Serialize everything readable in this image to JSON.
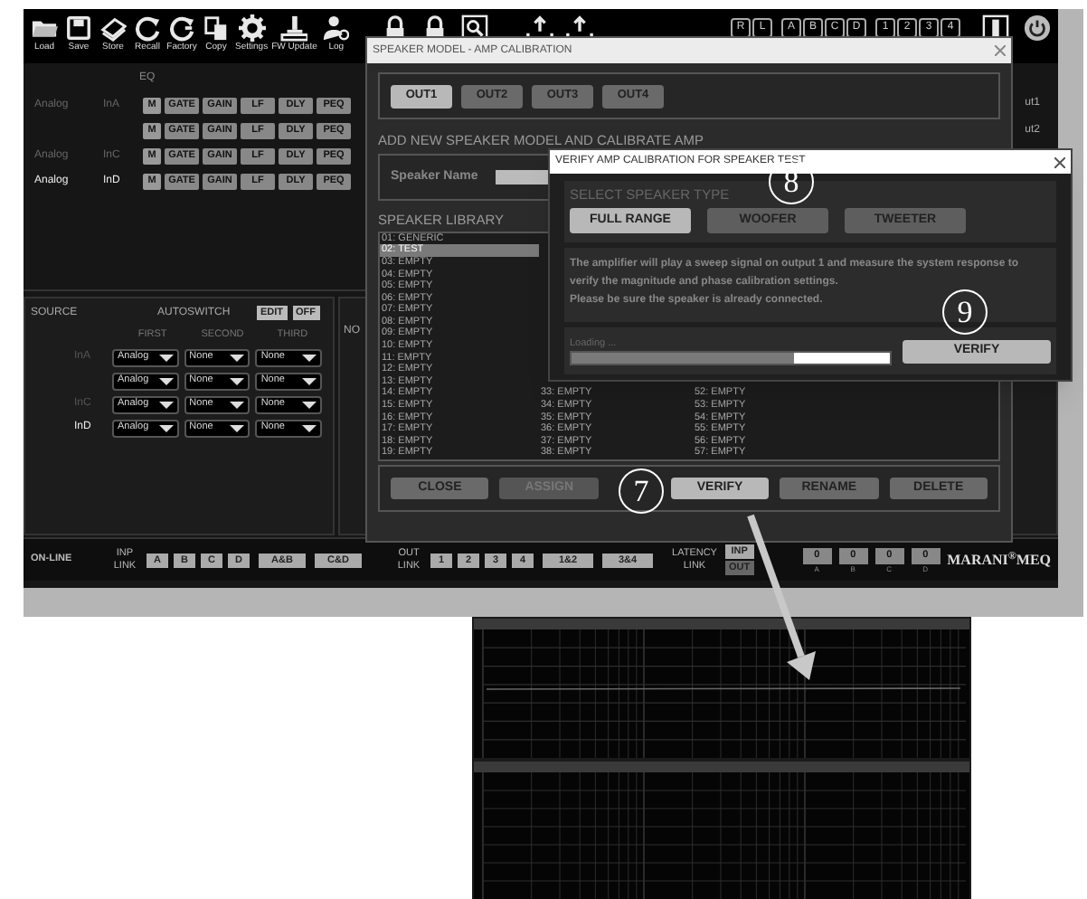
{
  "toolbar": {
    "buttons": [
      {
        "kind": "folder",
        "label": "Load"
      },
      {
        "kind": "floppy",
        "label": "Save"
      },
      {
        "kind": "store",
        "label": "Store"
      },
      {
        "kind": "recall",
        "label": "Recall"
      },
      {
        "kind": "factory",
        "label": "Factory"
      },
      {
        "kind": "copy",
        "label": "Copy"
      },
      {
        "kind": "gear",
        "label": "Settings"
      },
      {
        "kind": "joystick",
        "label": "FW Update"
      },
      {
        "kind": "user",
        "label": "Log"
      }
    ],
    "icons": [
      {
        "kind": "lock"
      },
      {
        "kind": "lock"
      },
      {
        "kind": "search"
      },
      {
        "kind": "upload"
      },
      {
        "kind": "upload"
      }
    ],
    "indicators": [
      "R",
      "L",
      "A",
      "B",
      "C",
      "D",
      "1",
      "2",
      "3",
      "4"
    ]
  },
  "routing": {
    "label": "EQ",
    "rows": [
      {
        "source": "Analog",
        "input": "InA",
        "active": false,
        "blocks": [
          "M",
          "GATE",
          "GAIN",
          "LF",
          "DLY",
          "PEQ"
        ]
      },
      {
        "blocks": [
          "M",
          "GATE",
          "GAIN",
          "LF",
          "DLY",
          "PEQ"
        ]
      },
      {
        "source": "Analog",
        "input": "InC",
        "active": false,
        "blocks": [
          "M",
          "GATE",
          "GAIN",
          "LF",
          "DLY",
          "PEQ"
        ]
      },
      {
        "source": "Analog",
        "input": "InD",
        "active": true,
        "blocks": [
          "M",
          "GATE",
          "GAIN",
          "LF",
          "DLY",
          "PEQ"
        ]
      }
    ],
    "outputs": [
      "ut1",
      "ut2"
    ]
  },
  "source_panel": {
    "title": "SOURCE",
    "autoswitch": "AUTOSWITCH",
    "edit": "EDIT",
    "off": "OFF",
    "next_panel": "NO",
    "columns": [
      "FIRST",
      "SECOND",
      "THIRD"
    ],
    "rows": [
      {
        "input": "InA",
        "active": false,
        "choices": [
          "Analog",
          "None",
          "None"
        ]
      },
      {
        "choices": [
          "Analog",
          "None",
          "None"
        ]
      },
      {
        "input": "InC",
        "active": false,
        "choices": [
          "Analog",
          "None",
          "None"
        ]
      },
      {
        "input": "InD",
        "active": true,
        "choices": [
          "Analog",
          "None",
          "None"
        ]
      }
    ]
  },
  "bottom_bar": {
    "status": "ON-LINE",
    "inp_link": "INP LINK",
    "inp_buttons": [
      "A",
      "B",
      "C",
      "D"
    ],
    "inp_pairs": [
      "A&B",
      "C&D"
    ],
    "out_link": "OUT LINK",
    "out_buttons": [
      "1",
      "2",
      "3",
      "4"
    ],
    "out_pairs": [
      "1&2",
      "3&4"
    ],
    "latency": "LATENCY LINK",
    "latency_buttons": [
      {
        "label": "INP",
        "selected": true
      },
      {
        "label": "OUT",
        "selected": false
      }
    ],
    "latency_values": [
      {
        "value": "0",
        "channel": "A"
      },
      {
        "value": "0",
        "channel": "B"
      },
      {
        "value": "0",
        "channel": "C"
      },
      {
        "value": "0",
        "channel": "D"
      }
    ],
    "brand": "MARANI$^{®}$MEQ"
  },
  "speaker_dialog": {
    "title": "SPEAKER MODEL - AMP CALIBRATION",
    "outputs": [
      {
        "label": "OUT1",
        "selected": true
      },
      {
        "label": "OUT2",
        "selected": false
      },
      {
        "label": "OUT3",
        "selected": false
      },
      {
        "label": "OUT4",
        "selected": false
      }
    ],
    "add_title": "ADD NEW SPEAKER MODEL AND CALIBRATE AMP",
    "name_label": "Speaker Name",
    "library_title": "SPEAKER LIBRARY",
    "library": [
      {
        "items": [
          {
            "label": "01: GENERIC",
            "selected": false
          },
          {
            "label": "02: TEST",
            "selected": true
          },
          {
            "label": "03: EMPTY",
            "selected": false
          },
          {
            "label": "04: EMPTY",
            "selected": false
          },
          {
            "label": "05: EMPTY",
            "selected": false
          },
          {
            "label": "06: EMPTY",
            "selected": false
          },
          {
            "label": "07: EMPTY",
            "selected": false
          },
          {
            "label": "08: EMPTY",
            "selected": false
          },
          {
            "label": "09: EMPTY",
            "selected": false
          },
          {
            "label": "10: EMPTY",
            "selected": false
          },
          {
            "label": "11: EMPTY",
            "selected": false
          },
          {
            "label": "12: EMPTY",
            "selected": false
          },
          {
            "label": "13: EMPTY",
            "selected": false
          },
          {
            "label": "14: EMPTY",
            "selected": false
          },
          {
            "label": "15: EMPTY",
            "selected": false
          },
          {
            "label": "16: EMPTY",
            "selected": false
          },
          {
            "label": "17: EMPTY",
            "selected": false
          },
          {
            "label": "18: EMPTY",
            "selected": false
          },
          {
            "label": "19: EMPTY",
            "selected": false
          }
        ]
      },
      {
        "items": [
          {
            "label": "33: EMPTY",
            "selected": false
          },
          {
            "label": "34: EMPTY",
            "selected": false
          },
          {
            "label": "35: EMPTY",
            "selected": false
          },
          {
            "label": "36: EMPTY",
            "selected": false
          },
          {
            "label": "37: EMPTY",
            "selected": false
          },
          {
            "label": "38: EMPTY",
            "selected": false
          }
        ]
      },
      {
        "items": [
          {
            "label": "52: EMPTY",
            "selected": false
          },
          {
            "label": "53: EMPTY",
            "selected": false
          },
          {
            "label": "54: EMPTY",
            "selected": false
          },
          {
            "label": "55: EMPTY",
            "selected": false
          },
          {
            "label": "56: EMPTY",
            "selected": false
          },
          {
            "label": "57: EMPTY",
            "selected": false
          }
        ]
      }
    ],
    "buttons": [
      {
        "label": "CLOSE",
        "disabled": false,
        "highlighted": false
      },
      {
        "label": "ASSIGN",
        "disabled": true,
        "highlighted": false
      },
      {
        "label": "VERIFY",
        "disabled": false,
        "highlighted": true
      },
      {
        "label": "RENAME",
        "disabled": false,
        "highlighted": false
      },
      {
        "label": "DELETE",
        "disabled": false,
        "highlighted": false
      }
    ]
  },
  "verify_dialog": {
    "title": "VERIFY AMP CALIBRATION FOR SPEAKER TEST",
    "section": "SELECT SPEAKER TYPE",
    "types": [
      {
        "label": "FULL RANGE",
        "selected": true
      },
      {
        "label": "WOOFER",
        "selected": false
      },
      {
        "label": "TWEETER",
        "selected": false
      }
    ],
    "message": [
      "The amplifier will play a sweep signal on output 1 and measure the system response to verify the magnitude and phase calibration settings.",
      "Please be sure the speaker is already connected."
    ],
    "loading": "Loading ...",
    "progress": {
      "level": 0.7
    },
    "button": "VERIFY"
  },
  "callouts": [
    "7",
    "8",
    "9"
  ]
}
